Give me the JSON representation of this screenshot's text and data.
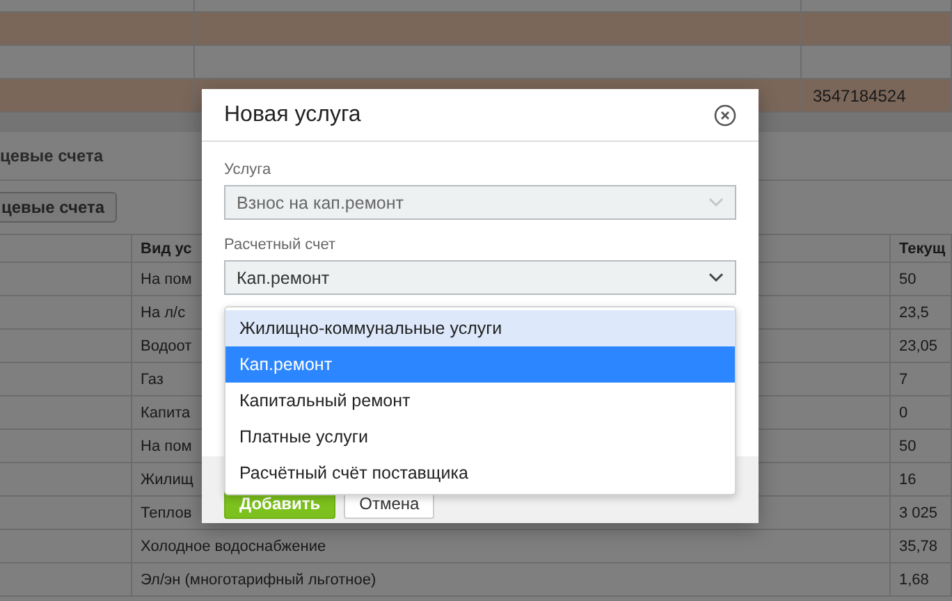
{
  "top_table": {
    "rows": [
      {
        "highlighted": false
      },
      {
        "highlighted": true
      },
      {
        "highlighted": false
      },
      {
        "highlighted": true,
        "column_3": "3547184524"
      }
    ]
  },
  "section": {
    "title": "цевые счета",
    "button": "цевые счета"
  },
  "services_table": {
    "columns": [
      "Вид ус",
      "Текущ"
    ],
    "rows": [
      {
        "service": "На пом",
        "current": "50"
      },
      {
        "service": "На л/с",
        "current": "23,5"
      },
      {
        "service": "Водоот",
        "current": "23,05"
      },
      {
        "service": "Газ",
        "current": "7"
      },
      {
        "service": "Капита",
        "current": "0"
      },
      {
        "service": "На пом",
        "current": "50"
      },
      {
        "service": "Жилищ",
        "current": "16"
      },
      {
        "service": "Теплов",
        "current": "3 025"
      },
      {
        "service": "Холодное водоснабжение",
        "current": "35,78"
      },
      {
        "service": "Эл/эн (многотарифный льготное)",
        "current": "1,68"
      }
    ]
  },
  "modal": {
    "title": "Новая услуга",
    "fields": [
      {
        "label": "Услуга",
        "value": "Взнос на кап.ремонт",
        "disabled": true,
        "open": false
      },
      {
        "label": "Расчетный счет",
        "value": "Кап.ремонт",
        "disabled": false,
        "open": true
      }
    ],
    "options": [
      {
        "label": "Жилищно-коммунальные услуги",
        "selected": false,
        "highlighted": true
      },
      {
        "label": "Кап.ремонт",
        "selected": true,
        "highlighted": false
      },
      {
        "label": "Капитальный ремонт",
        "selected": false,
        "highlighted": false
      },
      {
        "label": "Платные услуги",
        "selected": false,
        "highlighted": false
      },
      {
        "label": "Расчётный счёт поставщика",
        "selected": false,
        "highlighted": false
      }
    ],
    "buttons": [
      {
        "label": "Добавить",
        "kind": "primary"
      },
      {
        "label": "Отмена",
        "kind": "secondary"
      }
    ]
  }
}
